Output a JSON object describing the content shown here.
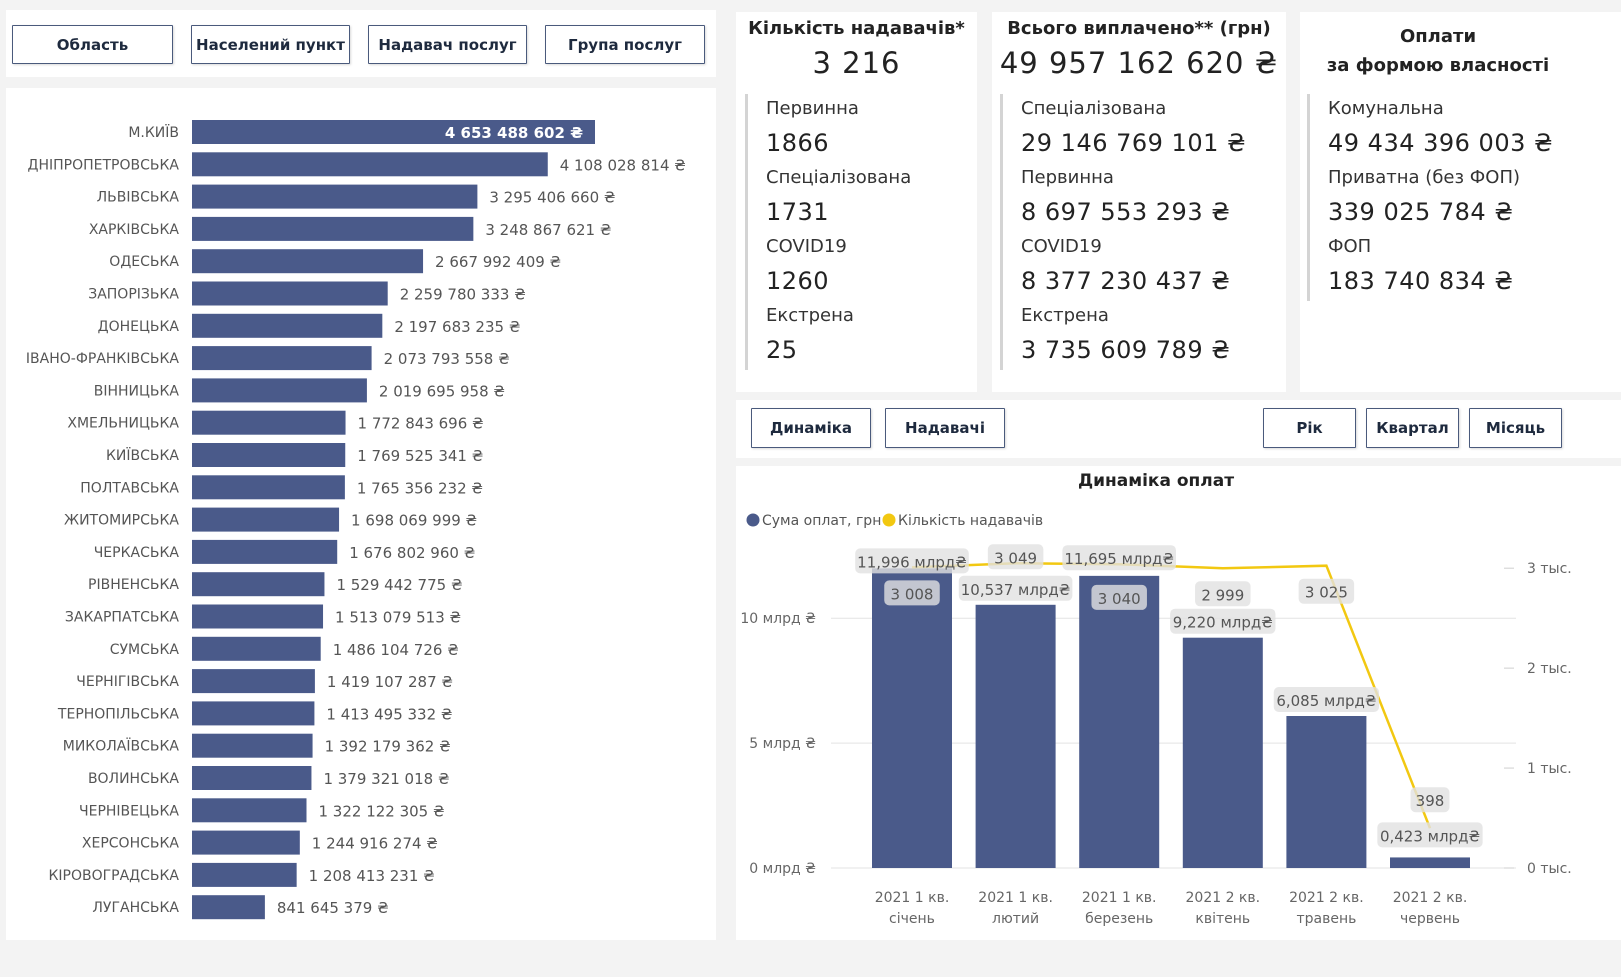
{
  "filters": {
    "region": "Область",
    "settlement": "Населений пункт",
    "provider": "Надавач послуг",
    "service_group": "Група послуг"
  },
  "region_chart": {
    "chart_data": {
      "type": "bar",
      "orientation": "horizontal",
      "categories": [
        "М.КИЇВ",
        "ДНІПРОПЕТРОВСЬКА",
        "ЛЬВІВСЬКА",
        "ХАРКІВСЬКА",
        "ОДЕСЬКА",
        "ЗАПОРІЗЬКА",
        "ДОНЕЦЬКА",
        "ІВАНО-ФРАНКІВСЬКА",
        "ВІННИЦЬКА",
        "ХМЕЛЬНИЦЬКА",
        "КИЇВСЬКА",
        "ПОЛТАВСЬКА",
        "ЖИТОМИРСЬКА",
        "ЧЕРКАСЬКА",
        "РІВНЕНСЬКА",
        "ЗАКАРПАТСЬКА",
        "СУМСЬКА",
        "ЧЕРНІГІВСЬКА",
        "ТЕРНОПІЛЬСЬКА",
        "МИКОЛАЇВСЬКА",
        "ВОЛИНСЬКА",
        "ЧЕРНІВЕЦЬКА",
        "ХЕРСОНСЬКА",
        "КІРОВОГРАДСЬКА",
        "ЛУГАНСЬКА"
      ],
      "values": [
        4653488602,
        4108028814,
        3295406660,
        3248867621,
        2667992409,
        2259780333,
        2197683235,
        2073793558,
        2019695958,
        1772843696,
        1769525341,
        1765356232,
        1698069999,
        1676802960,
        1529442775,
        1513079513,
        1486104726,
        1419107287,
        1413495332,
        1392179362,
        1379321018,
        1322122305,
        1244916274,
        1208413231,
        841645379
      ],
      "labels": [
        "4 653 488 602 ₴",
        "4 108 028 814 ₴",
        "3 295 406 660 ₴",
        "3 248 867 621 ₴",
        "2 667 992 409 ₴",
        "2 259 780 333 ₴",
        "2 197 683 235 ₴",
        "2 073 793 558 ₴",
        "2 019 695 958 ₴",
        "1 772 843 696 ₴",
        "1 769 525 341 ₴",
        "1 765 356 232 ₴",
        "1 698 069 999 ₴",
        "1 676 802 960 ₴",
        "1 529 442 775 ₴",
        "1 513 079 513 ₴",
        "1 486 104 726 ₴",
        "1 419 107 287 ₴",
        "1 413 495 332 ₴",
        "1 392 179 362 ₴",
        "1 379 321 018 ₴",
        "1 322 122 305 ₴",
        "1 244 916 274 ₴",
        "1 208 413 231 ₴",
        "841 645 379 ₴"
      ],
      "bar_color": "#4a5a8a"
    }
  },
  "providers_card": {
    "title": "Кількість надавачів*",
    "total": "3 216",
    "items": [
      {
        "label": "Первинна",
        "value": "1866"
      },
      {
        "label": "Спеціалізована",
        "value": "1731"
      },
      {
        "label": "COVID19",
        "value": "1260"
      },
      {
        "label": "Екстрена",
        "value": "25"
      }
    ]
  },
  "paid_card": {
    "title": "Всього виплачено** (грн)",
    "total": "49 957 162 620 ₴",
    "items": [
      {
        "label": "Спеціалізована",
        "value": "29 146 769 101 ₴"
      },
      {
        "label": "Первинна",
        "value": "8 697 553 293 ₴"
      },
      {
        "label": "COVID19",
        "value": "8 377 230 437 ₴"
      },
      {
        "label": "Екстрена",
        "value": "3 735 609 789 ₴"
      }
    ]
  },
  "ownership_card": {
    "title_line1": "Оплати",
    "title_line2": "за формою власності",
    "items": [
      {
        "label": "Комунальна",
        "value": "49 434 396 003 ₴"
      },
      {
        "label": "Приватна (без ФОП)",
        "value": "339 025 784 ₴"
      },
      {
        "label": "ФОП",
        "value": "183 740 834 ₴"
      }
    ]
  },
  "view_tabs": {
    "dynamics": "Динаміка",
    "providers": "Надавачі"
  },
  "period_tabs": {
    "year": "Рік",
    "quarter": "Квартал",
    "month": "Місяць"
  },
  "dynamics_chart": {
    "chart_data": {
      "type": "bar",
      "title": "Динаміка оплат",
      "legend_position": "top-left",
      "categories": [
        [
          "2021 1 кв.",
          "січень"
        ],
        [
          "2021 1 кв.",
          "лютий"
        ],
        [
          "2021 1 кв.",
          "березень"
        ],
        [
          "2021 2 кв.",
          "квітень"
        ],
        [
          "2021 2 кв.",
          "травень"
        ],
        [
          "2021 2 кв.",
          "червень"
        ]
      ],
      "series": [
        {
          "name": "Сума оплат, грн",
          "type": "bar",
          "color": "#4a5a8a",
          "values": [
            11.996,
            10.537,
            11.695,
            9.22,
            6.085,
            0.423
          ],
          "labels": [
            "11,996 млрд₴",
            "10,537 млрд₴",
            "11,695 млрд₴",
            "9,220 млрд₴",
            "6,085 млрд₴",
            "0,423 млрд₴"
          ]
        },
        {
          "name": "Кількість надавачів",
          "type": "line",
          "color": "#f2c811",
          "values": [
            3008,
            3049,
            3040,
            2999,
            3025,
            398
          ],
          "labels": [
            "3 008",
            "3 049",
            "3 040",
            "2 999",
            "3 025",
            "398"
          ]
        }
      ],
      "y_left": {
        "ticks": [
          0,
          5,
          10
        ],
        "tick_labels": [
          "0 млрд ₴",
          "5 млрд ₴",
          "10 млрд ₴"
        ],
        "range": [
          0,
          12.25
        ]
      },
      "y_right": {
        "ticks": [
          0,
          1000,
          2000,
          3000
        ],
        "tick_labels": [
          "0 тыс.",
          "1 тыс.",
          "2 тыс.",
          "3 тыс."
        ],
        "range": [
          0,
          3062
        ]
      },
      "grid": true
    }
  }
}
